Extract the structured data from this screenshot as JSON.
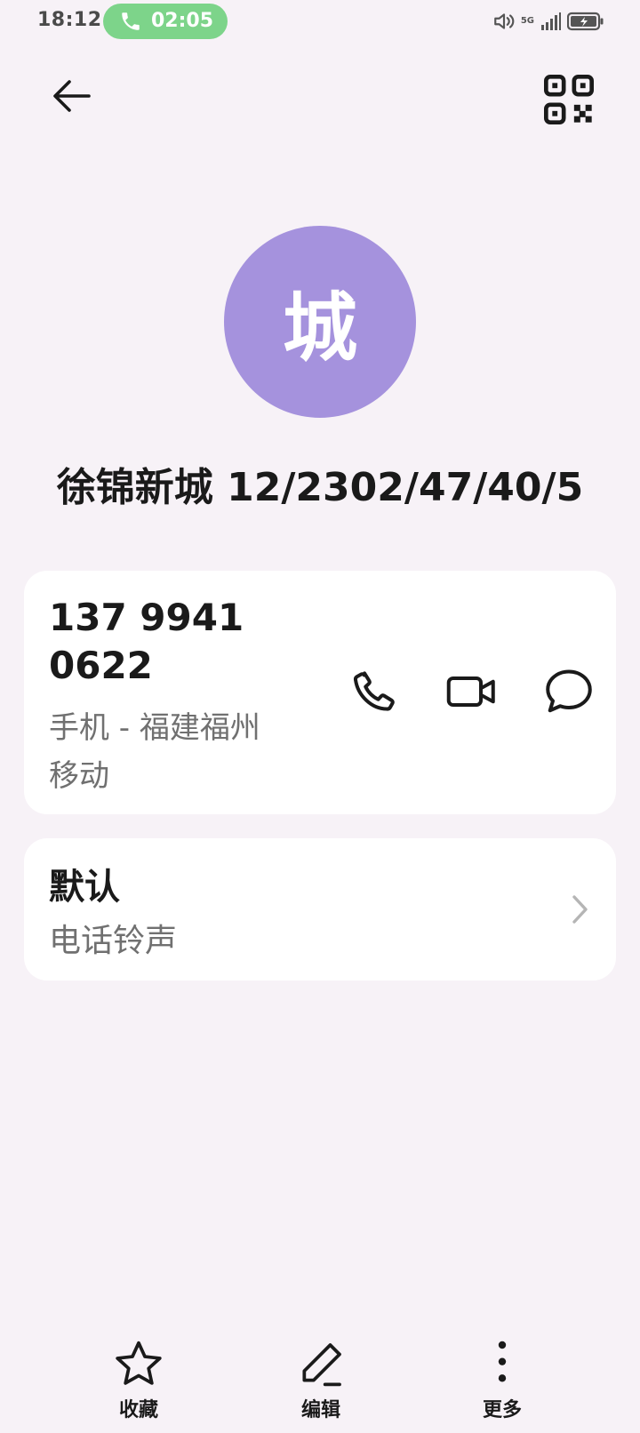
{
  "status_bar": {
    "time": "18:12",
    "call_duration": "02:05",
    "network": "5G",
    "call_pill_color": "#7dd48a"
  },
  "header": {
    "back_icon": "back-arrow-icon",
    "qr_icon": "qr-code-icon"
  },
  "contact": {
    "avatar_letter": "城",
    "avatar_color": "#a592dd",
    "name": "徐锦新城 12/2302/47/40/5"
  },
  "phone_card": {
    "number_line1": "137 9941",
    "number_line2": "0622",
    "type_line1": "手机 - 福建福州",
    "type_line2": "移动",
    "actions": [
      "phone-icon",
      "video-call-icon",
      "message-icon"
    ]
  },
  "ringtone_card": {
    "title": "默认",
    "subtitle": "电话铃声"
  },
  "bottom_bar": {
    "favorite_label": "收藏",
    "edit_label": "编辑",
    "more_label": "更多"
  }
}
